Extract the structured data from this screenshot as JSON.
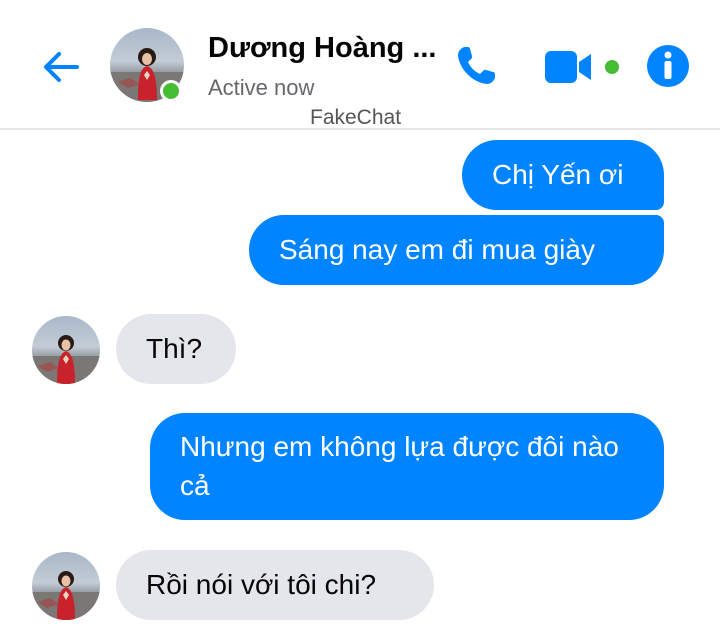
{
  "header": {
    "contact_name": "Dương Hoàng ...",
    "status": "Active now",
    "watermark": "FakeChat",
    "icons": {
      "back": "arrow-left-icon",
      "call": "phone-icon",
      "video": "video-camera-icon",
      "info": "info-icon"
    }
  },
  "messages": [
    {
      "direction": "outgoing",
      "text": "Chị Yến ơi"
    },
    {
      "direction": "outgoing",
      "text": "Sáng nay em đi mua giày"
    },
    {
      "direction": "incoming",
      "text": "Thì?"
    },
    {
      "direction": "outgoing",
      "text": "Nhưng em không lựa được đôi nào cả"
    },
    {
      "direction": "incoming",
      "text": "Rồi nói với tôi chi?"
    }
  ],
  "colors": {
    "accent": "#0084ff",
    "incoming_bubble": "#e4e6eb",
    "online": "#44bd32",
    "video_dot": "#44bd32"
  }
}
